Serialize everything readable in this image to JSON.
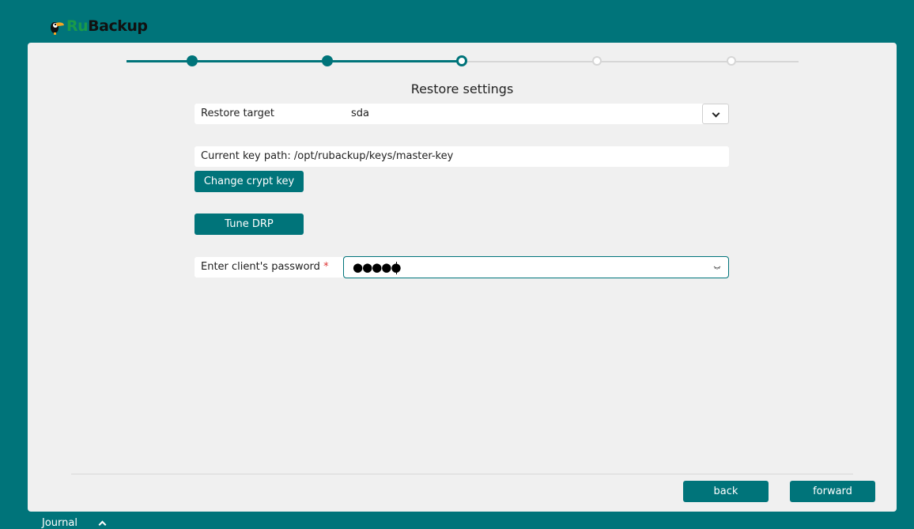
{
  "app": {
    "logo_ru": "Ru",
    "logo_backup": "Backup"
  },
  "wizard": {
    "title": "Restore settings",
    "steps": [
      "done",
      "done",
      "current",
      "todo",
      "todo"
    ]
  },
  "form": {
    "restore_target_label": "Restore target",
    "restore_target_value": "sda",
    "key_path_text": "Current key path: /opt/rubackup/keys/master-key",
    "change_crypt_key_label": "Change crypt key",
    "tune_drp_label": "Tune DRP",
    "password_label": "Enter client's password",
    "password_required_mark": "*",
    "password_masked": "●●●●●"
  },
  "nav": {
    "back_label": "back",
    "forward_label": "forward"
  },
  "footer": {
    "journal_label": "Journal"
  },
  "colors": {
    "accent": "#00747a",
    "panel": "#f0f0f0",
    "required": "#dd3333"
  }
}
